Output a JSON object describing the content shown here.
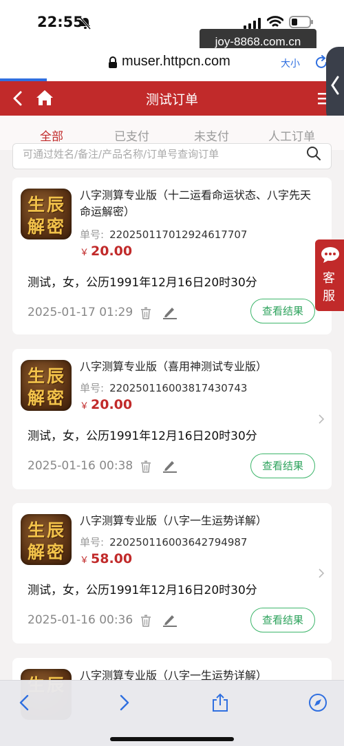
{
  "status_bar": {
    "time": "22:55",
    "watermark": "joy-8868.com.cn"
  },
  "browser": {
    "url": "muser.httpcn.com",
    "text_size_label": "大小",
    "accent_color": "#2f6fe0"
  },
  "header": {
    "title": "测试订单",
    "brand_color": "#c12a2a"
  },
  "tabs": [
    {
      "label": "全部",
      "active": true
    },
    {
      "label": "已支付",
      "active": false
    },
    {
      "label": "未支付",
      "active": false
    },
    {
      "label": "人工订单",
      "active": false
    }
  ],
  "search": {
    "placeholder": "可通过姓名/备注/产品名称/订单号查询订单"
  },
  "product_logo": {
    "chars": [
      "生",
      "辰",
      "解",
      "密"
    ]
  },
  "orders": [
    {
      "product_name": "八字测算专业版（十二运看命运状态、八字先天命运解密）",
      "order_no_label": "单号:",
      "order_no": "22025011701292461​7707",
      "price_symbol": "￥",
      "price": "20.00",
      "customer_info": "测试，女，公历1991年12月16日20时30分",
      "date": "2025-01-17 01:29",
      "button_label": "查看结果"
    },
    {
      "product_name": "八字测算专业版（喜用神测试专业版）",
      "order_no_label": "单号:",
      "order_no": "22025011600381743​0743",
      "price_symbol": "￥",
      "price": "20.00",
      "customer_info": "测试，女，公历1991年12月16日20时30分",
      "date": "2025-01-16 00:38",
      "button_label": "查看结果"
    },
    {
      "product_name": "八字测算专业版（八字一生运势详解）",
      "order_no_label": "单号:",
      "order_no": "22025011600364279​4987",
      "price_symbol": "￥",
      "price": "58.00",
      "customer_info": "测试，女，公历1991年12月16日20时30分",
      "date": "2025-01-16 00:36",
      "button_label": "查看结果"
    },
    {
      "product_name": "八字测算专业版（八字一生运势详解）"
    }
  ],
  "customer_service": {
    "label": "客服"
  },
  "icons": {
    "back": "chevron-left-icon",
    "home": "home-icon",
    "menu": "menu-icon",
    "search": "search-icon",
    "trash": "trash-icon",
    "edit": "edit-icon",
    "chat": "chat-bubble-icon",
    "share": "share-icon",
    "compass": "compass-icon"
  }
}
